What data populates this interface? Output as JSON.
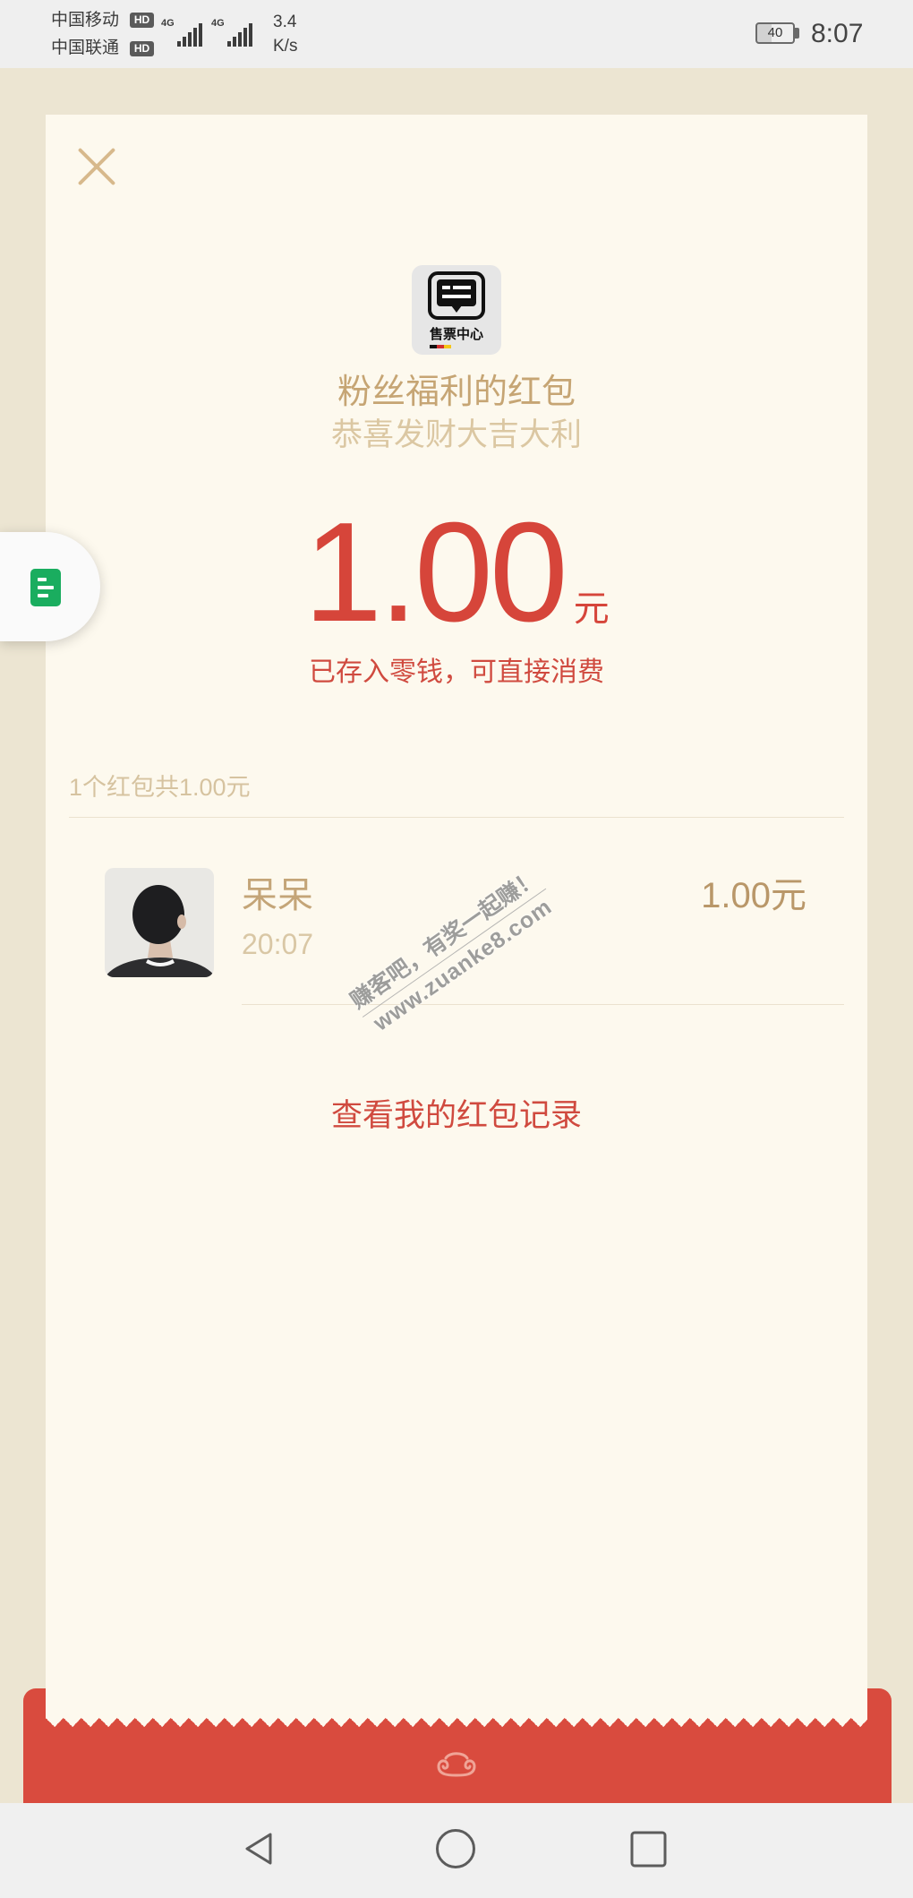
{
  "status_bar": {
    "carrier1": "中国移动",
    "carrier2": "中国联通",
    "hd_badge": "HD",
    "network1": "4G",
    "network2": "4G",
    "speed_value": "3.4",
    "speed_unit": "K/s",
    "battery": "40",
    "time": "8:07"
  },
  "packet": {
    "sender_logo_text": "售票中心",
    "title": "粉丝福利的红包",
    "blessing": "恭喜发财大吉大利",
    "amount": "1.00",
    "currency": "元",
    "note": "已存入零钱，可直接消费"
  },
  "summary": "1个红包共1.00元",
  "records": [
    {
      "name": "呆呆",
      "time": "20:07",
      "amount": "1.00元"
    }
  ],
  "view_records_link": "查看我的红包记录",
  "watermark": {
    "line1": "赚客吧，有奖一起赚！",
    "line2": "www.zuanke8.com"
  },
  "icons": {
    "close": "close-icon",
    "sender_logo": "chat-bubble-logo",
    "floating_button": "document-icon",
    "ornament": "cloud-ornament-icon",
    "nav_back": "back-triangle-icon",
    "nav_home": "home-circle-icon",
    "nav_recents": "recents-square-icon"
  },
  "colors": {
    "frame_background": "#ece5d2",
    "card_background": "#fdf9ee",
    "accent_red": "#d6453a",
    "base_red": "#d94b3e",
    "gold_text": "#c6a574",
    "muted_gold_text": "#d9c7a5",
    "doc_green": "#1aad5f"
  }
}
